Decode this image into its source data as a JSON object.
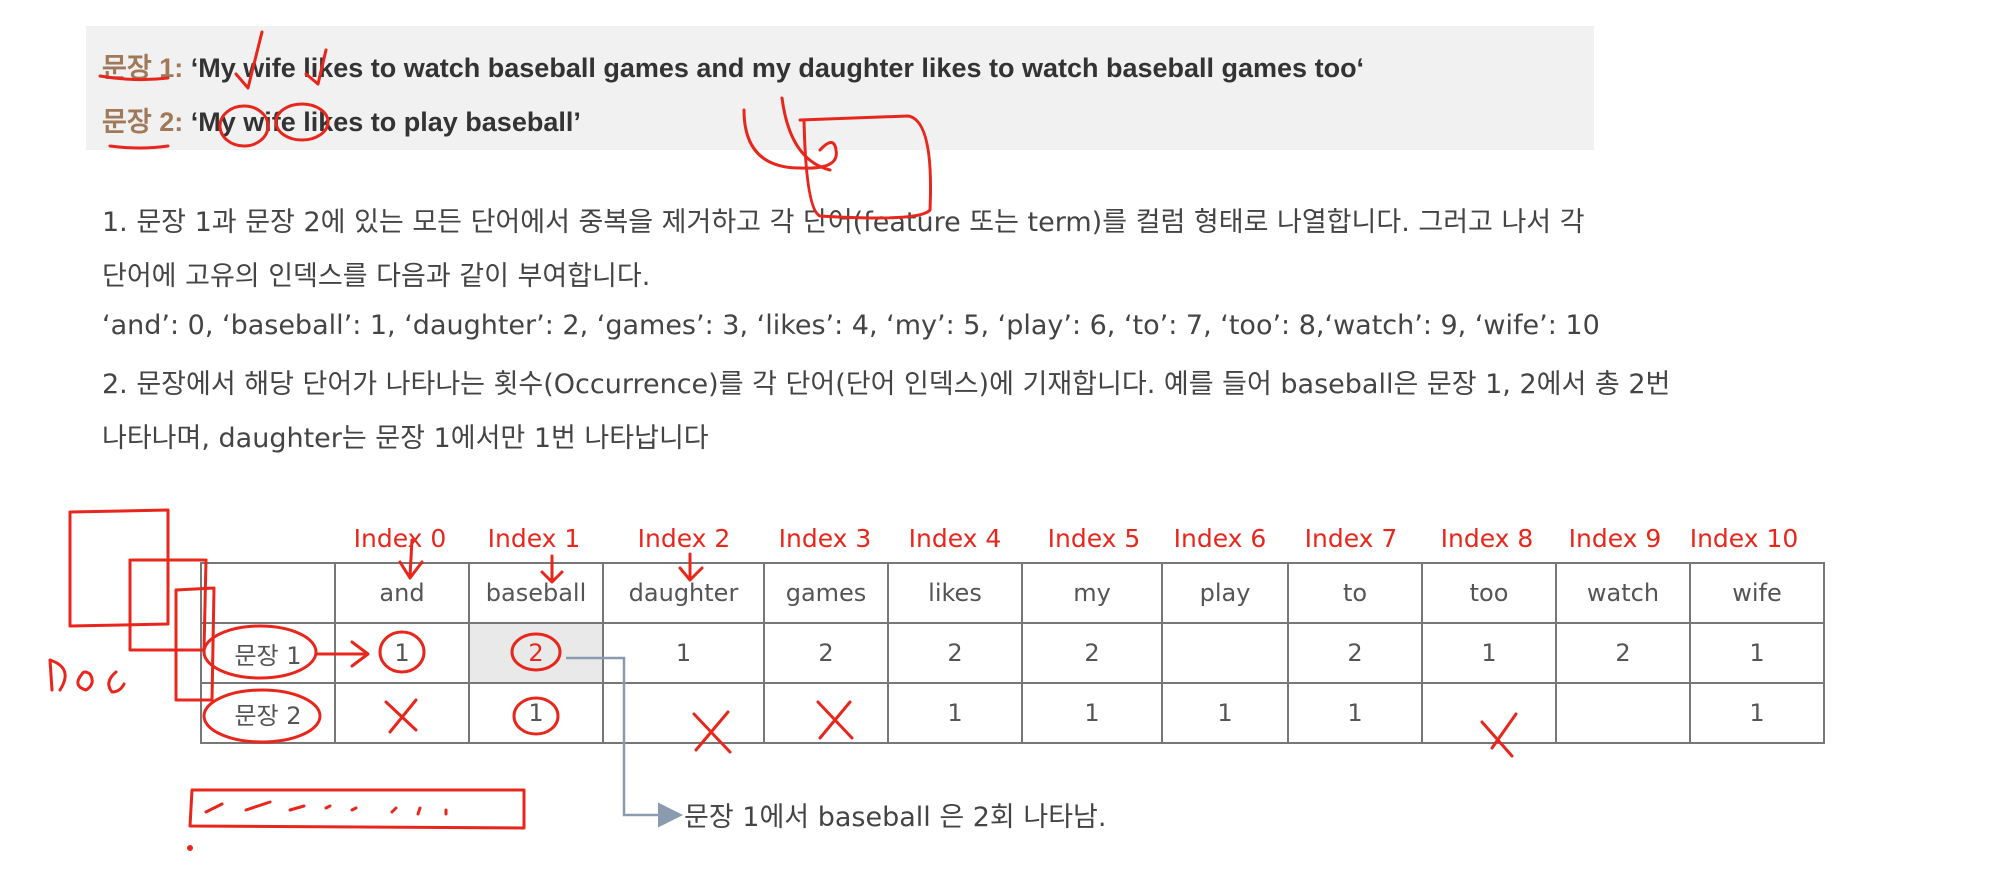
{
  "sentences": [
    {
      "label": "문장",
      "num": " 1:",
      "text": " ‘My wife likes to watch baseball games and my daughter likes to watch baseball games too‘"
    },
    {
      "label": "문장",
      "num": " 2:",
      "text": " ‘My wife likes to play baseball’"
    }
  ],
  "paragraphs": {
    "step1_line1": "1. 문장 1과 문장 2에 있는 모든 단어에서 중복을 제거하고 각 단어(feature 또는 term)를 컬럼 형태로 나열합니다. 그러고 나서 각",
    "step1_line2": "단어에 고유의 인덱스를 다음과 같이 부여합니다.",
    "index_map": "‘and’: 0, ‘baseball’: 1, ‘daughter’: 2, ‘games’: 3, ‘likes’: 4, ‘my’: 5, ‘play’: 6, ‘to’: 7, ‘too’: 8,‘watch’: 9, ‘wife’: 10",
    "step2_line1": "2. 문장에서 해당 단어가 나타나는 횟수(Occurrence)를 각 단어(단어 인덱스)에 기재합니다. 예를 들어 baseball은 문장 1, 2에서 총 2번",
    "step2_line2": "나타나며, daughter는 문장 1에서만 1번 나타납니다"
  },
  "index_labels": [
    "Index 0",
    "Index 1",
    "Index 2",
    "Index 3",
    "Index 4",
    "Index 5",
    "Index 6",
    "Index 7",
    "Index 8",
    "Index 9",
    "Index 10"
  ],
  "table": {
    "columns": [
      "and",
      "baseball",
      "daughter",
      "games",
      "likes",
      "my",
      "play",
      "to",
      "too",
      "watch",
      "wife"
    ],
    "rows": [
      {
        "label": "문장 1",
        "values": [
          "1",
          "2",
          "1",
          "2",
          "2",
          "2",
          "",
          "2",
          "1",
          "2",
          "1"
        ]
      },
      {
        "label": "문장 2",
        "values": [
          "",
          "1",
          "",
          "",
          "1",
          "1",
          "1",
          "1",
          "",
          "",
          "1"
        ]
      }
    ]
  },
  "note": "문장 1에서 baseball 은 2회 나타남.",
  "handwriting": {
    "doc_label": "Doc"
  },
  "colors": {
    "annotation_red": "#e8261c",
    "sentence_label": "#a0785a",
    "arrow_gray": "#8a9bb0"
  }
}
